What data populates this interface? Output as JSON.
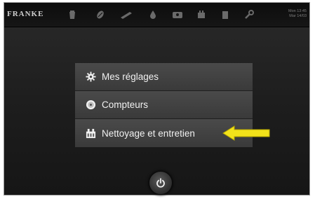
{
  "header": {
    "logo_text": "FRANKE",
    "icons": [
      "cup-icon",
      "bean-icon",
      "blade-icon",
      "water-drop-icon",
      "milk-icon",
      "cleaning-icon",
      "container-icon",
      "wrench-icon"
    ],
    "time_line1": "Mon 13:45",
    "time_line2": "Mar 14/03"
  },
  "menu": {
    "items": [
      {
        "label": "Mes réglages",
        "icon": "gear-icon"
      },
      {
        "label": "Compteurs",
        "icon": "counter-icon"
      },
      {
        "label": "Nettoyage et entretien",
        "icon": "cleaning-icon"
      }
    ]
  },
  "annotation": {
    "arrow_color": "#f3e21a",
    "points_to": "Nettoyage et entretien"
  },
  "power_button": {
    "icon": "power-icon"
  },
  "colors": {
    "background": "#1f1f1f",
    "menu_item": "#404040",
    "text": "#f1f1f1",
    "arrow": "#f3e21a"
  }
}
